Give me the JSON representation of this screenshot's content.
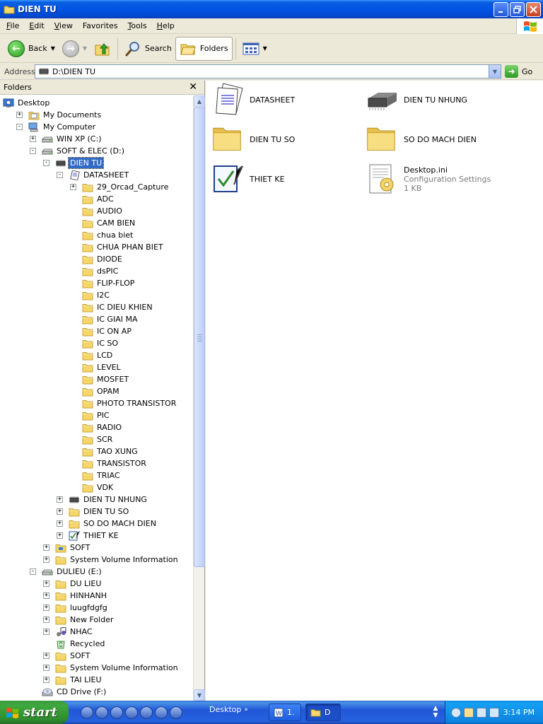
{
  "window": {
    "title": "DIEN TU"
  },
  "menu": [
    {
      "label": "File",
      "accel": "F",
      "rest": "ile"
    },
    {
      "label": "Edit",
      "accel": "E",
      "rest": "dit"
    },
    {
      "label": "View",
      "accel": "V",
      "rest": "iew"
    },
    {
      "label": "Favorites",
      "accel": "",
      "rest": ""
    },
    {
      "label": "Tools",
      "accel": "T",
      "rest": "ools"
    },
    {
      "label": "Help",
      "accel": "H",
      "rest": "elp"
    }
  ],
  "toolbar": {
    "back": "Back",
    "search": "Search",
    "folders": "Folders"
  },
  "address": {
    "label": "Address",
    "value": "D:\\DIEN TU",
    "go": "Go"
  },
  "folders_pane": {
    "title": "Folders",
    "tree": [
      {
        "label": "Desktop",
        "level": 0,
        "exp": "",
        "icon": "desktop-icon"
      },
      {
        "label": "My Documents",
        "level": 1,
        "exp": "+",
        "icon": "my-documents-icon"
      },
      {
        "label": "My Computer",
        "level": 1,
        "exp": "−",
        "icon": "computer-icon"
      },
      {
        "label": "WIN XP (C:)",
        "level": 2,
        "exp": "+",
        "icon": "drive-icon"
      },
      {
        "label": "SOFT & ELEC (D:)",
        "level": 2,
        "exp": "−",
        "icon": "drive-icon"
      },
      {
        "label": "DIEN TU",
        "level": 3,
        "exp": "−",
        "icon": "chip-icon",
        "selected": true
      },
      {
        "label": "DATASHEET",
        "level": 4,
        "exp": "−",
        "icon": "datasheet-icon"
      },
      {
        "label": "29_Orcad_Capture",
        "level": 5,
        "exp": "+",
        "icon": "folder-icon"
      },
      {
        "label": "ADC",
        "level": 5,
        "exp": "",
        "icon": "folder-icon"
      },
      {
        "label": "AUDIO",
        "level": 5,
        "exp": "",
        "icon": "folder-icon"
      },
      {
        "label": "CAM BIEN",
        "level": 5,
        "exp": "",
        "icon": "folder-icon"
      },
      {
        "label": "chua biet",
        "level": 5,
        "exp": "",
        "icon": "folder-icon"
      },
      {
        "label": "CHUA PHAN BIET",
        "level": 5,
        "exp": "",
        "icon": "folder-icon"
      },
      {
        "label": "DIODE",
        "level": 5,
        "exp": "",
        "icon": "folder-icon"
      },
      {
        "label": "dsPIC",
        "level": 5,
        "exp": "",
        "icon": "folder-icon"
      },
      {
        "label": "FLIP-FLOP",
        "level": 5,
        "exp": "",
        "icon": "folder-icon"
      },
      {
        "label": "I2C",
        "level": 5,
        "exp": "",
        "icon": "folder-icon"
      },
      {
        "label": "IC DIEU KHIEN",
        "level": 5,
        "exp": "",
        "icon": "folder-icon"
      },
      {
        "label": "IC GIAI MA",
        "level": 5,
        "exp": "",
        "icon": "folder-icon"
      },
      {
        "label": "IC ON AP",
        "level": 5,
        "exp": "",
        "icon": "folder-icon"
      },
      {
        "label": "IC SO",
        "level": 5,
        "exp": "",
        "icon": "folder-icon"
      },
      {
        "label": "LCD",
        "level": 5,
        "exp": "",
        "icon": "folder-icon"
      },
      {
        "label": "LEVEL",
        "level": 5,
        "exp": "",
        "icon": "folder-icon"
      },
      {
        "label": "MOSFET",
        "level": 5,
        "exp": "",
        "icon": "folder-icon"
      },
      {
        "label": "OPAM",
        "level": 5,
        "exp": "",
        "icon": "folder-icon"
      },
      {
        "label": "PHOTO TRANSISTOR",
        "level": 5,
        "exp": "",
        "icon": "folder-icon"
      },
      {
        "label": "PIC",
        "level": 5,
        "exp": "",
        "icon": "folder-icon"
      },
      {
        "label": "RADIO",
        "level": 5,
        "exp": "",
        "icon": "folder-icon"
      },
      {
        "label": "SCR",
        "level": 5,
        "exp": "",
        "icon": "folder-icon"
      },
      {
        "label": "TAO XUNG",
        "level": 5,
        "exp": "",
        "icon": "folder-icon"
      },
      {
        "label": "TRANSISTOR",
        "level": 5,
        "exp": "",
        "icon": "folder-icon"
      },
      {
        "label": "TRIAC",
        "level": 5,
        "exp": "",
        "icon": "folder-icon"
      },
      {
        "label": "VDK",
        "level": 5,
        "exp": "",
        "icon": "folder-icon"
      },
      {
        "label": "DIEN TU NHUNG",
        "level": 4,
        "exp": "+",
        "icon": "chip-icon"
      },
      {
        "label": "DIEN TU SO",
        "level": 4,
        "exp": "+",
        "icon": "folder-icon"
      },
      {
        "label": "SO DO MACH DIEN",
        "level": 4,
        "exp": "+",
        "icon": "folder-icon"
      },
      {
        "label": "THIET KE",
        "level": 4,
        "exp": "+",
        "icon": "checklist-icon"
      },
      {
        "label": "SOFT",
        "level": 3,
        "exp": "+",
        "icon": "network-folder-icon"
      },
      {
        "label": "System Volume Information",
        "level": 3,
        "exp": "+",
        "icon": "folder-icon"
      },
      {
        "label": "DULIEU (E:)",
        "level": 2,
        "exp": "−",
        "icon": "drive-icon"
      },
      {
        "label": "DU LIEU",
        "level": 3,
        "exp": "+",
        "icon": "folder-icon"
      },
      {
        "label": "HINHANH",
        "level": 3,
        "exp": "+",
        "icon": "folder-icon"
      },
      {
        "label": "luugfdgfg",
        "level": 3,
        "exp": "+",
        "icon": "folder-icon"
      },
      {
        "label": "New Folder",
        "level": 3,
        "exp": "+",
        "icon": "folder-icon"
      },
      {
        "label": "NHAC",
        "level": 3,
        "exp": "+",
        "icon": "music-icon"
      },
      {
        "label": "Recycled",
        "level": 3,
        "exp": "",
        "icon": "recycle-icon"
      },
      {
        "label": "SOFT",
        "level": 3,
        "exp": "+",
        "icon": "folder-icon"
      },
      {
        "label": "System Volume Information",
        "level": 3,
        "exp": "+",
        "icon": "folder-icon"
      },
      {
        "label": "TAI LIEU",
        "level": 3,
        "exp": "+",
        "icon": "folder-icon"
      },
      {
        "label": "CD Drive (F:)",
        "level": 2,
        "exp": "",
        "icon": "cd-drive-icon"
      }
    ]
  },
  "content": {
    "items": [
      {
        "name": "DATASHEET",
        "icon": "datasheet-icon"
      },
      {
        "name": "DIEN TU NHUNG",
        "icon": "chip-icon"
      },
      {
        "name": "DIEN TU SO",
        "icon": "folder-icon"
      },
      {
        "name": "SO DO MACH DIEN",
        "icon": "folder-icon"
      },
      {
        "name": "THIET KE",
        "icon": "checklist-icon"
      },
      {
        "name": "Desktop.ini",
        "sub1": "Configuration Settings",
        "sub2": "1 KB",
        "icon": "config-file-icon"
      }
    ]
  },
  "taskbar": {
    "start": "start",
    "desktop_band": "Desktop",
    "tasks": [
      {
        "label": "1."
      },
      {
        "label": "D"
      }
    ],
    "clock": "3:14 PM"
  },
  "colors": {
    "titlebar": "#0054e3",
    "selection": "#316ac5",
    "start": "#3ea93e",
    "folder": "#f5d66b"
  }
}
